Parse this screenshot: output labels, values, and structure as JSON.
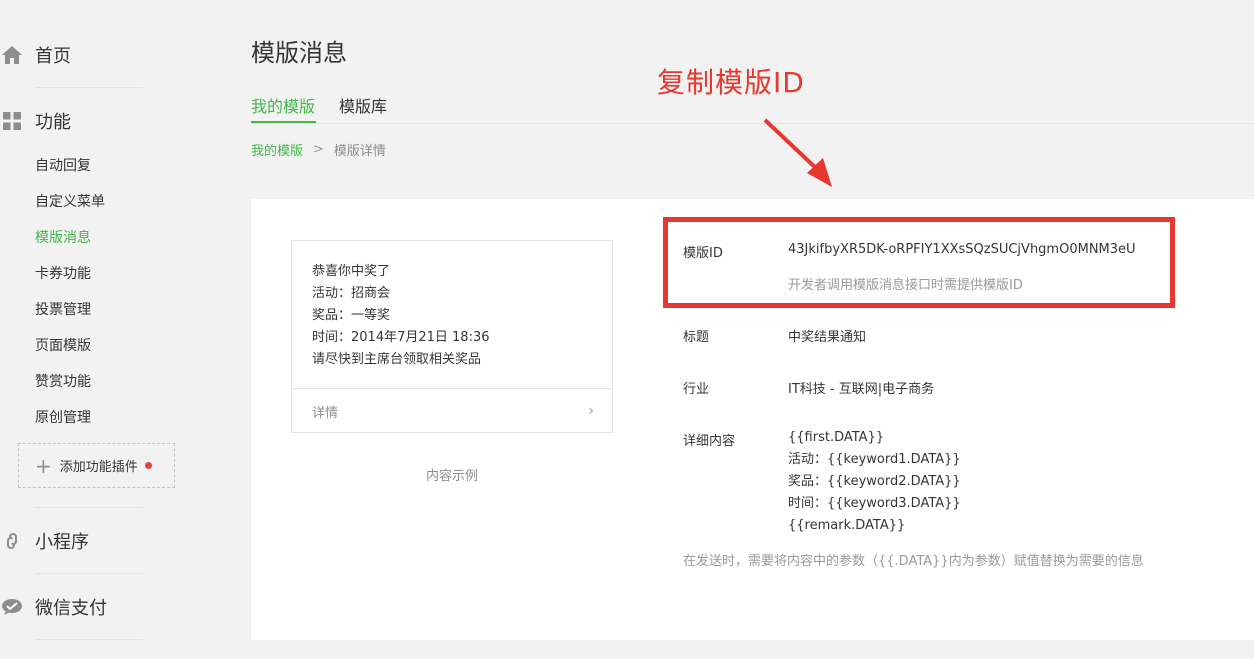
{
  "sidebar": {
    "home": {
      "label": "首页",
      "icon": "home-icon"
    },
    "features": {
      "label": "功能",
      "icon": "grid-icon"
    },
    "sub_items": [
      {
        "label": "自动回复",
        "active": false
      },
      {
        "label": "自定义菜单",
        "active": false
      },
      {
        "label": "模版消息",
        "active": true
      },
      {
        "label": "卡券功能",
        "active": false
      },
      {
        "label": "投票管理",
        "active": false
      },
      {
        "label": "页面模版",
        "active": false
      },
      {
        "label": "赞赏功能",
        "active": false
      },
      {
        "label": "原创管理",
        "active": false
      }
    ],
    "add_plugin": {
      "label": "添加功能插件",
      "icon": "plus-icon"
    },
    "mini_program": {
      "label": "小程序",
      "icon": "link-icon"
    },
    "wechat_pay": {
      "label": "微信支付",
      "icon": "wechat-pay-icon"
    }
  },
  "main": {
    "title": "模版消息",
    "tabs": [
      {
        "label": "我的模版",
        "active": true
      },
      {
        "label": "模版库",
        "active": false
      }
    ],
    "breadcrumb": {
      "link": "我的模版",
      "separator": ">",
      "current": "模版详情"
    },
    "preview": {
      "lines": [
        "恭喜你中奖了",
        "活动：招商会",
        "奖品：一等奖",
        "时间：2014年7月21日 18:36",
        "请尽快到主席台领取相关奖品"
      ],
      "footer_label": "详情",
      "caption": "内容示例"
    },
    "details": {
      "template_id_label": "模版ID",
      "template_id_value": "43JkifbyXR5DK-oRPFIY1XXsSQzSUCjVhgmO0MNM3eU",
      "template_id_hint": "开发者调用模版消息接口时需提供模版ID",
      "title_label": "标题",
      "title_value": "中奖结果通知",
      "industry_label": "行业",
      "industry_value": "IT科技 - 互联网|电子商务",
      "content_label": "详细内容",
      "content_lines": [
        "{{first.DATA}}",
        "活动：{{keyword1.DATA}}",
        "奖品：{{keyword2.DATA}}",
        "时间：{{keyword3.DATA}}",
        "{{remark.DATA}}"
      ],
      "content_hint": "在发送时，需要将内容中的参数（{{.DATA}}内为参数）赋值替换为需要的信息"
    }
  },
  "annotation": {
    "text": "复制模版ID",
    "color": "#e8372f"
  },
  "colors": {
    "accent": "#44b549",
    "annotation": "#e8372f",
    "background": "#f2f2f2"
  }
}
